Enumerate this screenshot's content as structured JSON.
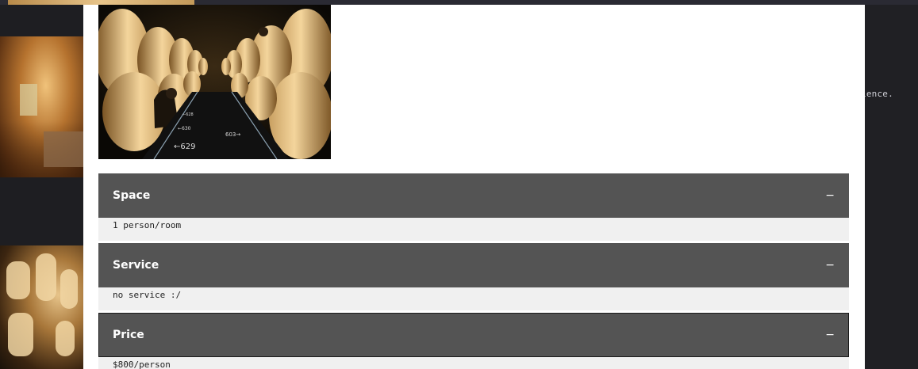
{
  "background": {
    "side_text": "ience."
  },
  "accordion": [
    {
      "title": "Space",
      "toggle": "−",
      "content": "1 person/room"
    },
    {
      "title": "Service",
      "toggle": "−",
      "content": "no service :/"
    },
    {
      "title": "Price",
      "toggle": "−",
      "content": "$800/person"
    }
  ],
  "hero": {
    "floor_labels": [
      "←629",
      "603→",
      "←630",
      "←628"
    ]
  },
  "colors": {
    "accordion_header": "#545454",
    "accordion_body": "#f0f0f0",
    "backdrop": "#1e1e22"
  }
}
